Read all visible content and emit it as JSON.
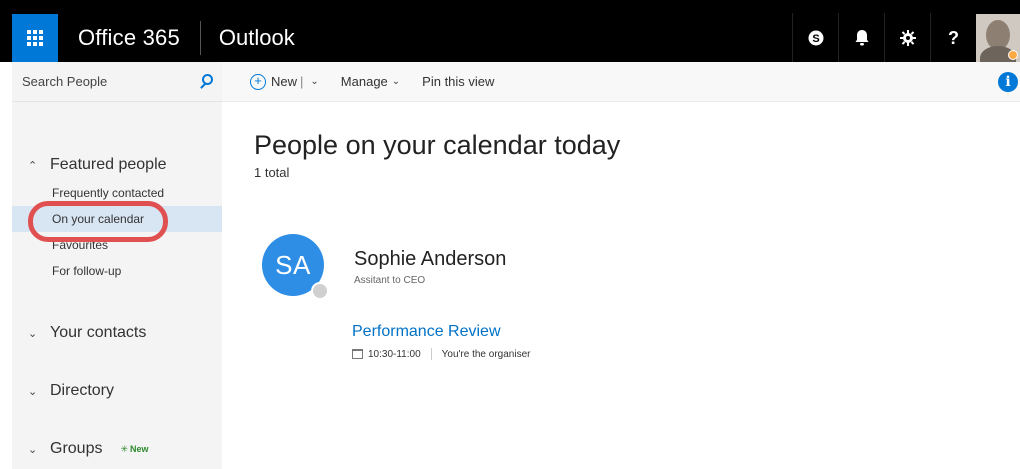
{
  "topbar": {
    "brand": "Office 365",
    "app": "Outlook",
    "icons": [
      "app-launcher-icon",
      "skype-icon",
      "bell-icon",
      "gear-icon",
      "help-icon"
    ],
    "accent": "#0078d7"
  },
  "search": {
    "placeholder": "Search People"
  },
  "toolbar": {
    "new_label": "New",
    "new_separator": "|",
    "manage_label": "Manage",
    "pin_label": "Pin this view"
  },
  "nav": {
    "featured": {
      "label": "Featured people",
      "items": [
        "Frequently contacted",
        "On your calendar",
        "Favourites",
        "For follow-up"
      ],
      "active": "On your calendar"
    },
    "your_contacts": "Your contacts",
    "directory": "Directory",
    "groups": {
      "label": "Groups",
      "badge": "New"
    }
  },
  "main": {
    "title": "People on your calendar today",
    "total": "1 total",
    "contact": {
      "initials": "SA",
      "name": "Sophie Anderson",
      "role": "Assitant to CEO",
      "avatar_color": "#2e8ee6"
    },
    "event": {
      "title": "Performance Review",
      "time": "10:30-11:00",
      "organiser": "You're the organiser"
    }
  }
}
